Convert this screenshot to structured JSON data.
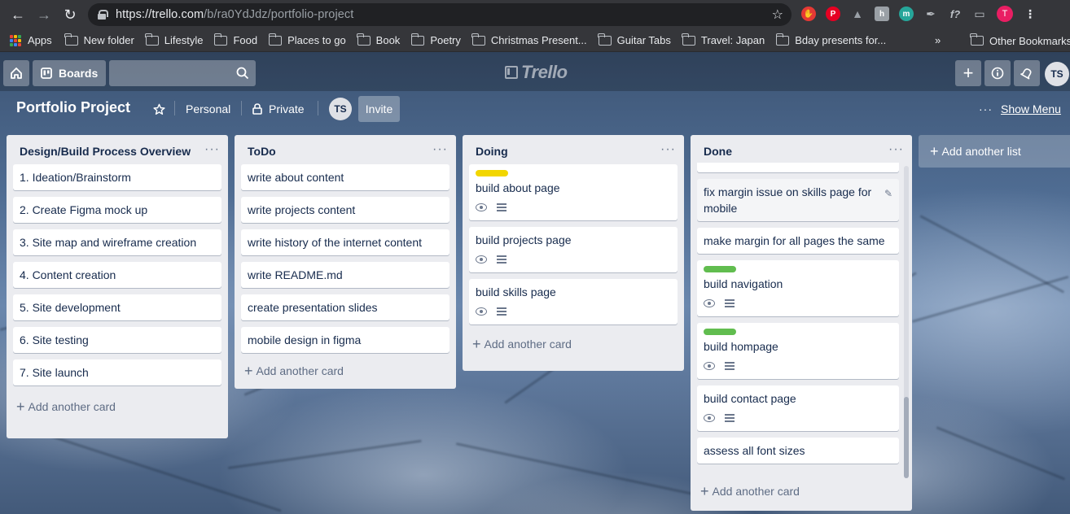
{
  "browser": {
    "url_host": "https://trello.com",
    "url_path": "/b/ra0YdJdz/portfolio-project",
    "profile_initial": "T",
    "bookmarks": [
      "Apps",
      "New folder",
      "Lifestyle",
      "Food",
      "Places to go",
      "Book",
      "Poetry",
      "Christmas Present...",
      "Guitar Tabs",
      "Travel: Japan",
      "Bday presents for..."
    ],
    "bookmarks_more": "»",
    "other_bookmarks": "Other Bookmarks"
  },
  "trello": {
    "boards_label": "Boards",
    "logo_text": "Trello",
    "member_initials": "TS"
  },
  "board": {
    "title": "Portfolio Project",
    "team": "Personal",
    "visibility": "Private",
    "member_initials": "TS",
    "invite_label": "Invite",
    "show_menu_label": "Show Menu",
    "add_list_label": "Add another list"
  },
  "lists": [
    {
      "title": "Design/Build Process Overview",
      "add_card": "Add another card",
      "cards": [
        {
          "text": "1. Ideation/Brainstorm"
        },
        {
          "text": "2. Create Figma mock up"
        },
        {
          "text": "3. Site map and wireframe creation"
        },
        {
          "text": "4. Content creation"
        },
        {
          "text": "5. Site development"
        },
        {
          "text": "6. Site testing"
        },
        {
          "text": "7. Site launch"
        }
      ]
    },
    {
      "title": "ToDo",
      "add_card": "Add another card",
      "cards": [
        {
          "text": "write about content"
        },
        {
          "text": "write projects content"
        },
        {
          "text": "write history of the internet content"
        },
        {
          "text": "write README.md"
        },
        {
          "text": "create presentation slides"
        },
        {
          "text": "mobile design in figma"
        }
      ]
    },
    {
      "title": "Doing",
      "add_card": "Add another card",
      "cards": [
        {
          "text": "build about page",
          "label_color": "#f2d600",
          "badges": true
        },
        {
          "text": "build projects page",
          "badges": true
        },
        {
          "text": "build skills page",
          "badges": true
        }
      ]
    },
    {
      "title": "Done",
      "add_card": "Add another card",
      "cards": [
        {
          "text": "fix margin issue on skills page for mobile",
          "hover": true
        },
        {
          "text": "make margin for all pages the same"
        },
        {
          "text": "build navigation",
          "label_color": "#61bd4f",
          "badges": true
        },
        {
          "text": "build hompage",
          "label_color": "#61bd4f",
          "badges": true
        },
        {
          "text": "build contact page",
          "badges": true
        },
        {
          "text": "assess all font sizes"
        }
      ]
    }
  ],
  "colors": {
    "green_label": "#61bd4f",
    "yellow_label": "#f2d600",
    "list_bg": "#ebecf0"
  }
}
